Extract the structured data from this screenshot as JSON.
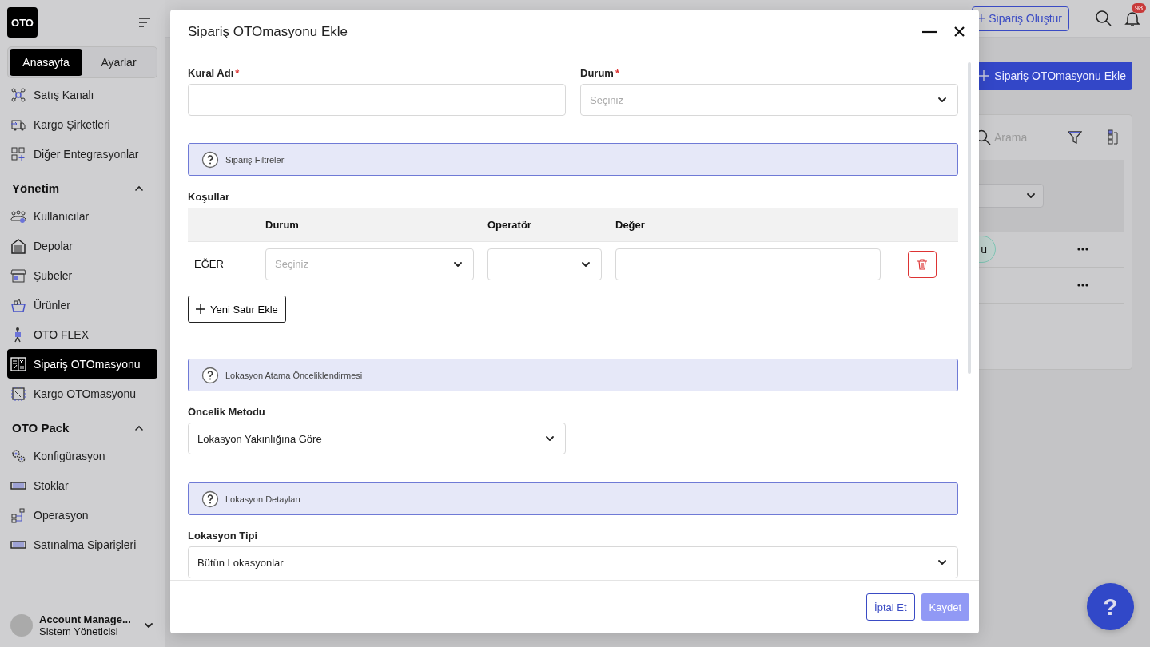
{
  "sidebar": {
    "logo": "OTO",
    "tabs": [
      {
        "label": "Anasayfa",
        "selected": true
      },
      {
        "label": "Ayarlar",
        "selected": false
      }
    ],
    "sections": [
      {
        "items": [
          {
            "label": "Satış Kanalı",
            "selected": false
          },
          {
            "label": "Kargo Şirketleri",
            "selected": false
          },
          {
            "label": "Diğer Entegrasyonlar",
            "selected": false
          }
        ]
      },
      {
        "title": "Yönetim",
        "expanded": true,
        "items": [
          {
            "label": "Kullanıcılar",
            "selected": false
          },
          {
            "label": "Depolar",
            "selected": false
          },
          {
            "label": "Şubeler",
            "selected": false
          },
          {
            "label": "Ürünler",
            "selected": false
          },
          {
            "label": "OTO FLEX",
            "selected": false
          },
          {
            "label": "Sipariş OTOmasyonu",
            "selected": true
          },
          {
            "label": "Kargo OTOmasyonu",
            "selected": false
          }
        ]
      },
      {
        "title": "OTO Pack",
        "expanded": true,
        "items": [
          {
            "label": "Konfigürasyon",
            "selected": false
          },
          {
            "label": "Stoklar",
            "selected": false
          },
          {
            "label": "Operasyon",
            "selected": false
          },
          {
            "label": "Satınalma Siparişleri",
            "selected": false
          }
        ]
      }
    ],
    "account": {
      "name": "Account Manage...",
      "role": "Sistem Yöneticisi"
    }
  },
  "header": {
    "create_button": "Sipariş Oluştur",
    "notification_count": "98"
  },
  "page": {
    "add_button": "Sipariş OTOmasyonu Ekle",
    "search": {
      "placeholder": "Arama"
    },
    "row_chip": "u"
  },
  "modal": {
    "title": "Sipariş OTOmasyonu Ekle",
    "name_field": {
      "label": "Kural Adı",
      "required_mark": "*"
    },
    "status_field": {
      "label": "Durum",
      "required_mark": "*",
      "placeholder": "Seçiniz"
    },
    "filters_info": "Sipariş Filtreleri",
    "conditions": {
      "label": "Koşullar",
      "columns": [
        "Durum",
        "Operatör",
        "Değer"
      ],
      "rows": [
        {
          "label": "EĞER",
          "status_placeholder": "Seçiniz"
        }
      ],
      "add_button": "Yeni Satır Ekle"
    },
    "priority_info": "Lokasyon Atama Önceliklendirmesi",
    "priority_field": {
      "label": "Öncelik Metodu",
      "value": "Lokasyon Yakınlığına Göre"
    },
    "details_info": "Lokasyon Detayları",
    "location_type_field": {
      "label": "Lokasyon Tipi",
      "value": "Bütün Lokasyonlar"
    },
    "cancel_button": "İptal Et",
    "save_button": {
      "label": "Kaydet",
      "disabled": true
    }
  },
  "help_button": "?"
}
